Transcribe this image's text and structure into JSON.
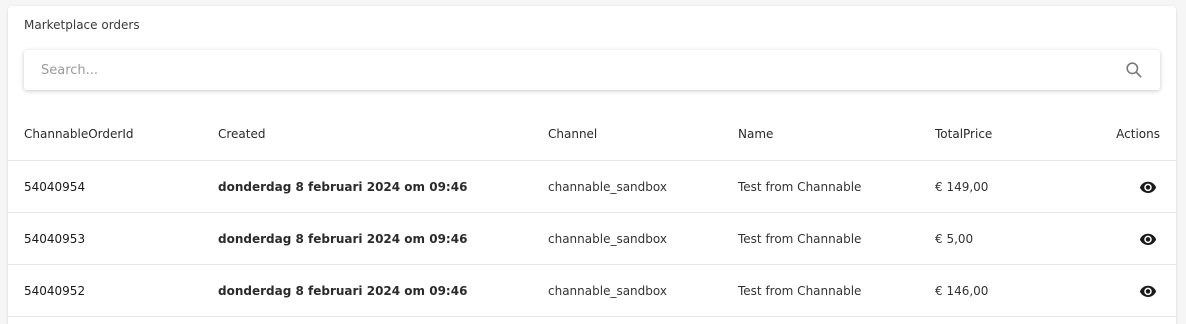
{
  "panel": {
    "title": "Marketplace orders"
  },
  "search": {
    "placeholder": "Search...",
    "value": "",
    "icon": "search-icon"
  },
  "table": {
    "columns": [
      "ChannableOrderId",
      "Created",
      "Channel",
      "Name",
      "TotalPrice",
      "Actions"
    ],
    "rows": [
      {
        "id": "54040954",
        "created": "donderdag 8 februari 2024 om 09:46",
        "channel": "channable_sandbox",
        "name": "Test from Channable",
        "total": "€ 149,00",
        "action_icon": "eye-icon"
      },
      {
        "id": "54040953",
        "created": "donderdag 8 februari 2024 om 09:46",
        "channel": "channable_sandbox",
        "name": "Test from Channable",
        "total": "€ 5,00",
        "action_icon": "eye-icon"
      },
      {
        "id": "54040952",
        "created": "donderdag 8 februari 2024 om 09:46",
        "channel": "channable_sandbox",
        "name": "Test from Channable",
        "total": "€ 146,00",
        "action_icon": "eye-icon"
      }
    ]
  }
}
